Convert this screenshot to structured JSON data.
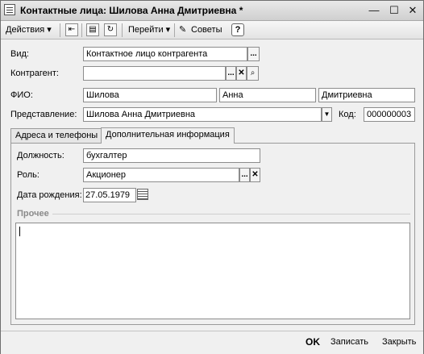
{
  "window": {
    "title": "Контактные лица: Шилова Анна Дмитриевна *",
    "minimize": "—",
    "maximize": "☐",
    "close": "✕"
  },
  "toolbar": {
    "actions": "Действия ▾",
    "goto": "Перейти ▾",
    "tips": "Советы",
    "help": "?",
    "icons": [
      "arrow-left-icon",
      "document-icon",
      "refresh-document-icon",
      "advice-icon"
    ]
  },
  "form": {
    "kind_label": "Вид:",
    "kind_value": "Контактное лицо контрагента",
    "counterparty_label": "Контрагент:",
    "counterparty_value": "",
    "fio_label": "ФИО:",
    "last_name": "Шилова",
    "first_name": "Анна",
    "middle_name": "Дмитриевна",
    "representation_label": "Представление:",
    "representation_value": "Шилова Анна Дмитриевна",
    "code_label": "Код:",
    "code_value": "000000003",
    "ellipsis": "...",
    "clear": "✕",
    "search": "🔍",
    "dropdown": "▼"
  },
  "tabs": [
    {
      "label": "Адреса и телефоны",
      "active": false
    },
    {
      "label": "Дополнительная информация",
      "active": true
    }
  ],
  "details": {
    "position_label": "Должность:",
    "position_value": "бухгалтер",
    "role_label": "Роль:",
    "role_value": "Акционер",
    "birth_label": "Дата рождения:",
    "birth_value": "27.05.1979",
    "other_group": "Прочее",
    "other_text": ""
  },
  "footer": {
    "ok": "OK",
    "save": "Записать",
    "close": "Закрыть"
  }
}
